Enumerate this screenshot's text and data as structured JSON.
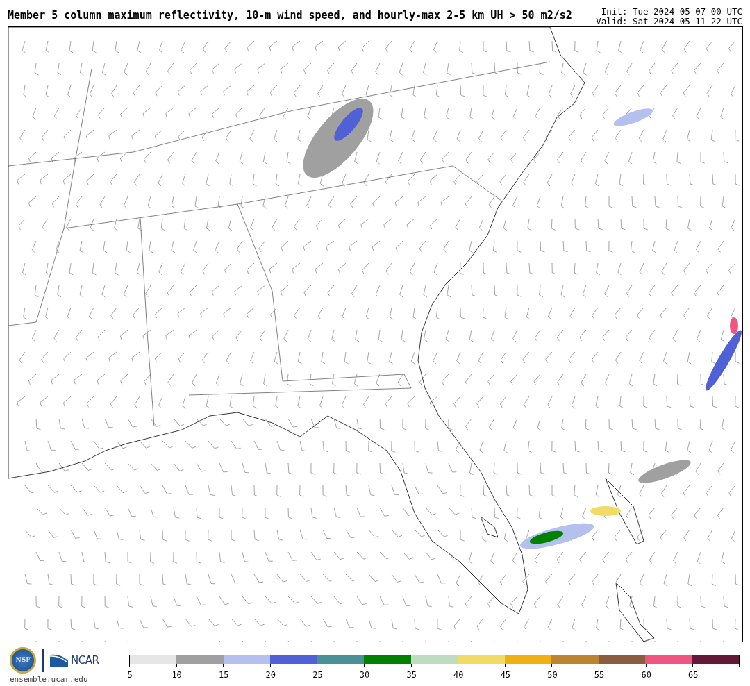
{
  "title": "Member 5 column maximum reflectivity, 10-m wind speed, and hourly-max 2-5 km UH > 50 m2/s2",
  "init": "Init: Tue 2024-05-07 00 UTC",
  "valid": "Valid: Sat 2024-05-11 22 UTC",
  "logo": {
    "nsf": "NSF",
    "ncar": "NCAR",
    "site": "ensemble.ucar.edu"
  },
  "colorbar": {
    "bins": [
      {
        "color": "#e6e6e6",
        "tick": "5"
      },
      {
        "color": "#a0a0a0",
        "tick": "10"
      },
      {
        "color": "#b4c0ee",
        "tick": "15"
      },
      {
        "color": "#5060d6",
        "tick": "20"
      },
      {
        "color": "#4a9098",
        "tick": "25"
      },
      {
        "color": "#008200",
        "tick": "30"
      },
      {
        "color": "#bfdcc0",
        "tick": "35"
      },
      {
        "color": "#f0dc64",
        "tick": "40"
      },
      {
        "color": "#f0b014",
        "tick": "45"
      },
      {
        "color": "#bc8430",
        "tick": "50"
      },
      {
        "color": "#8c5c40",
        "tick": "55"
      },
      {
        "color": "#f05480",
        "tick": "60"
      },
      {
        "color": "#641838",
        "tick": "65"
      }
    ]
  }
}
